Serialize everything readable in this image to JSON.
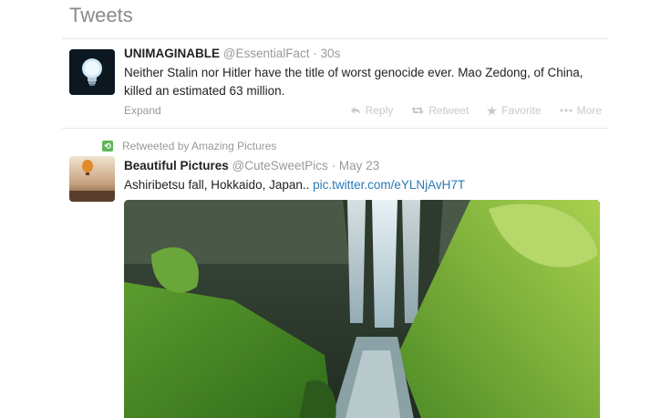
{
  "header": {
    "title": "Tweets"
  },
  "tweets": [
    {
      "name": "UNIMAGINABLE",
      "handle": "@EssentialFact",
      "separator": "·",
      "time": "30s",
      "text": "Neither Stalin nor Hitler have the title of worst genocide ever. Mao Zedong, of China, killed an estimated 63 million.",
      "expand_label": "Expand",
      "actions": {
        "reply": "Reply",
        "retweet": "Retweet",
        "favorite": "Favorite",
        "more": "More"
      }
    },
    {
      "retweeted_by": "Retweeted by Amazing Pictures",
      "name": "Beautiful Pictures",
      "handle": "@CuteSweetPics",
      "separator": "·",
      "time": "May 23",
      "text": "Ashiribetsu fall, Hokkaido, Japan..",
      "link": "pic.twitter.com/eYLNjAvH7T"
    }
  ],
  "icons": {
    "lightbulb": "lightbulb-icon",
    "balloon": "hot-air-balloon-icon",
    "retweet": "retweet-icon",
    "reply": "reply-icon",
    "favorite": "star-icon",
    "more": "ellipsis-icon"
  },
  "colors": {
    "link": "#2a7ab5",
    "retweet_green": "#5fb65a",
    "muted": "#999999"
  }
}
